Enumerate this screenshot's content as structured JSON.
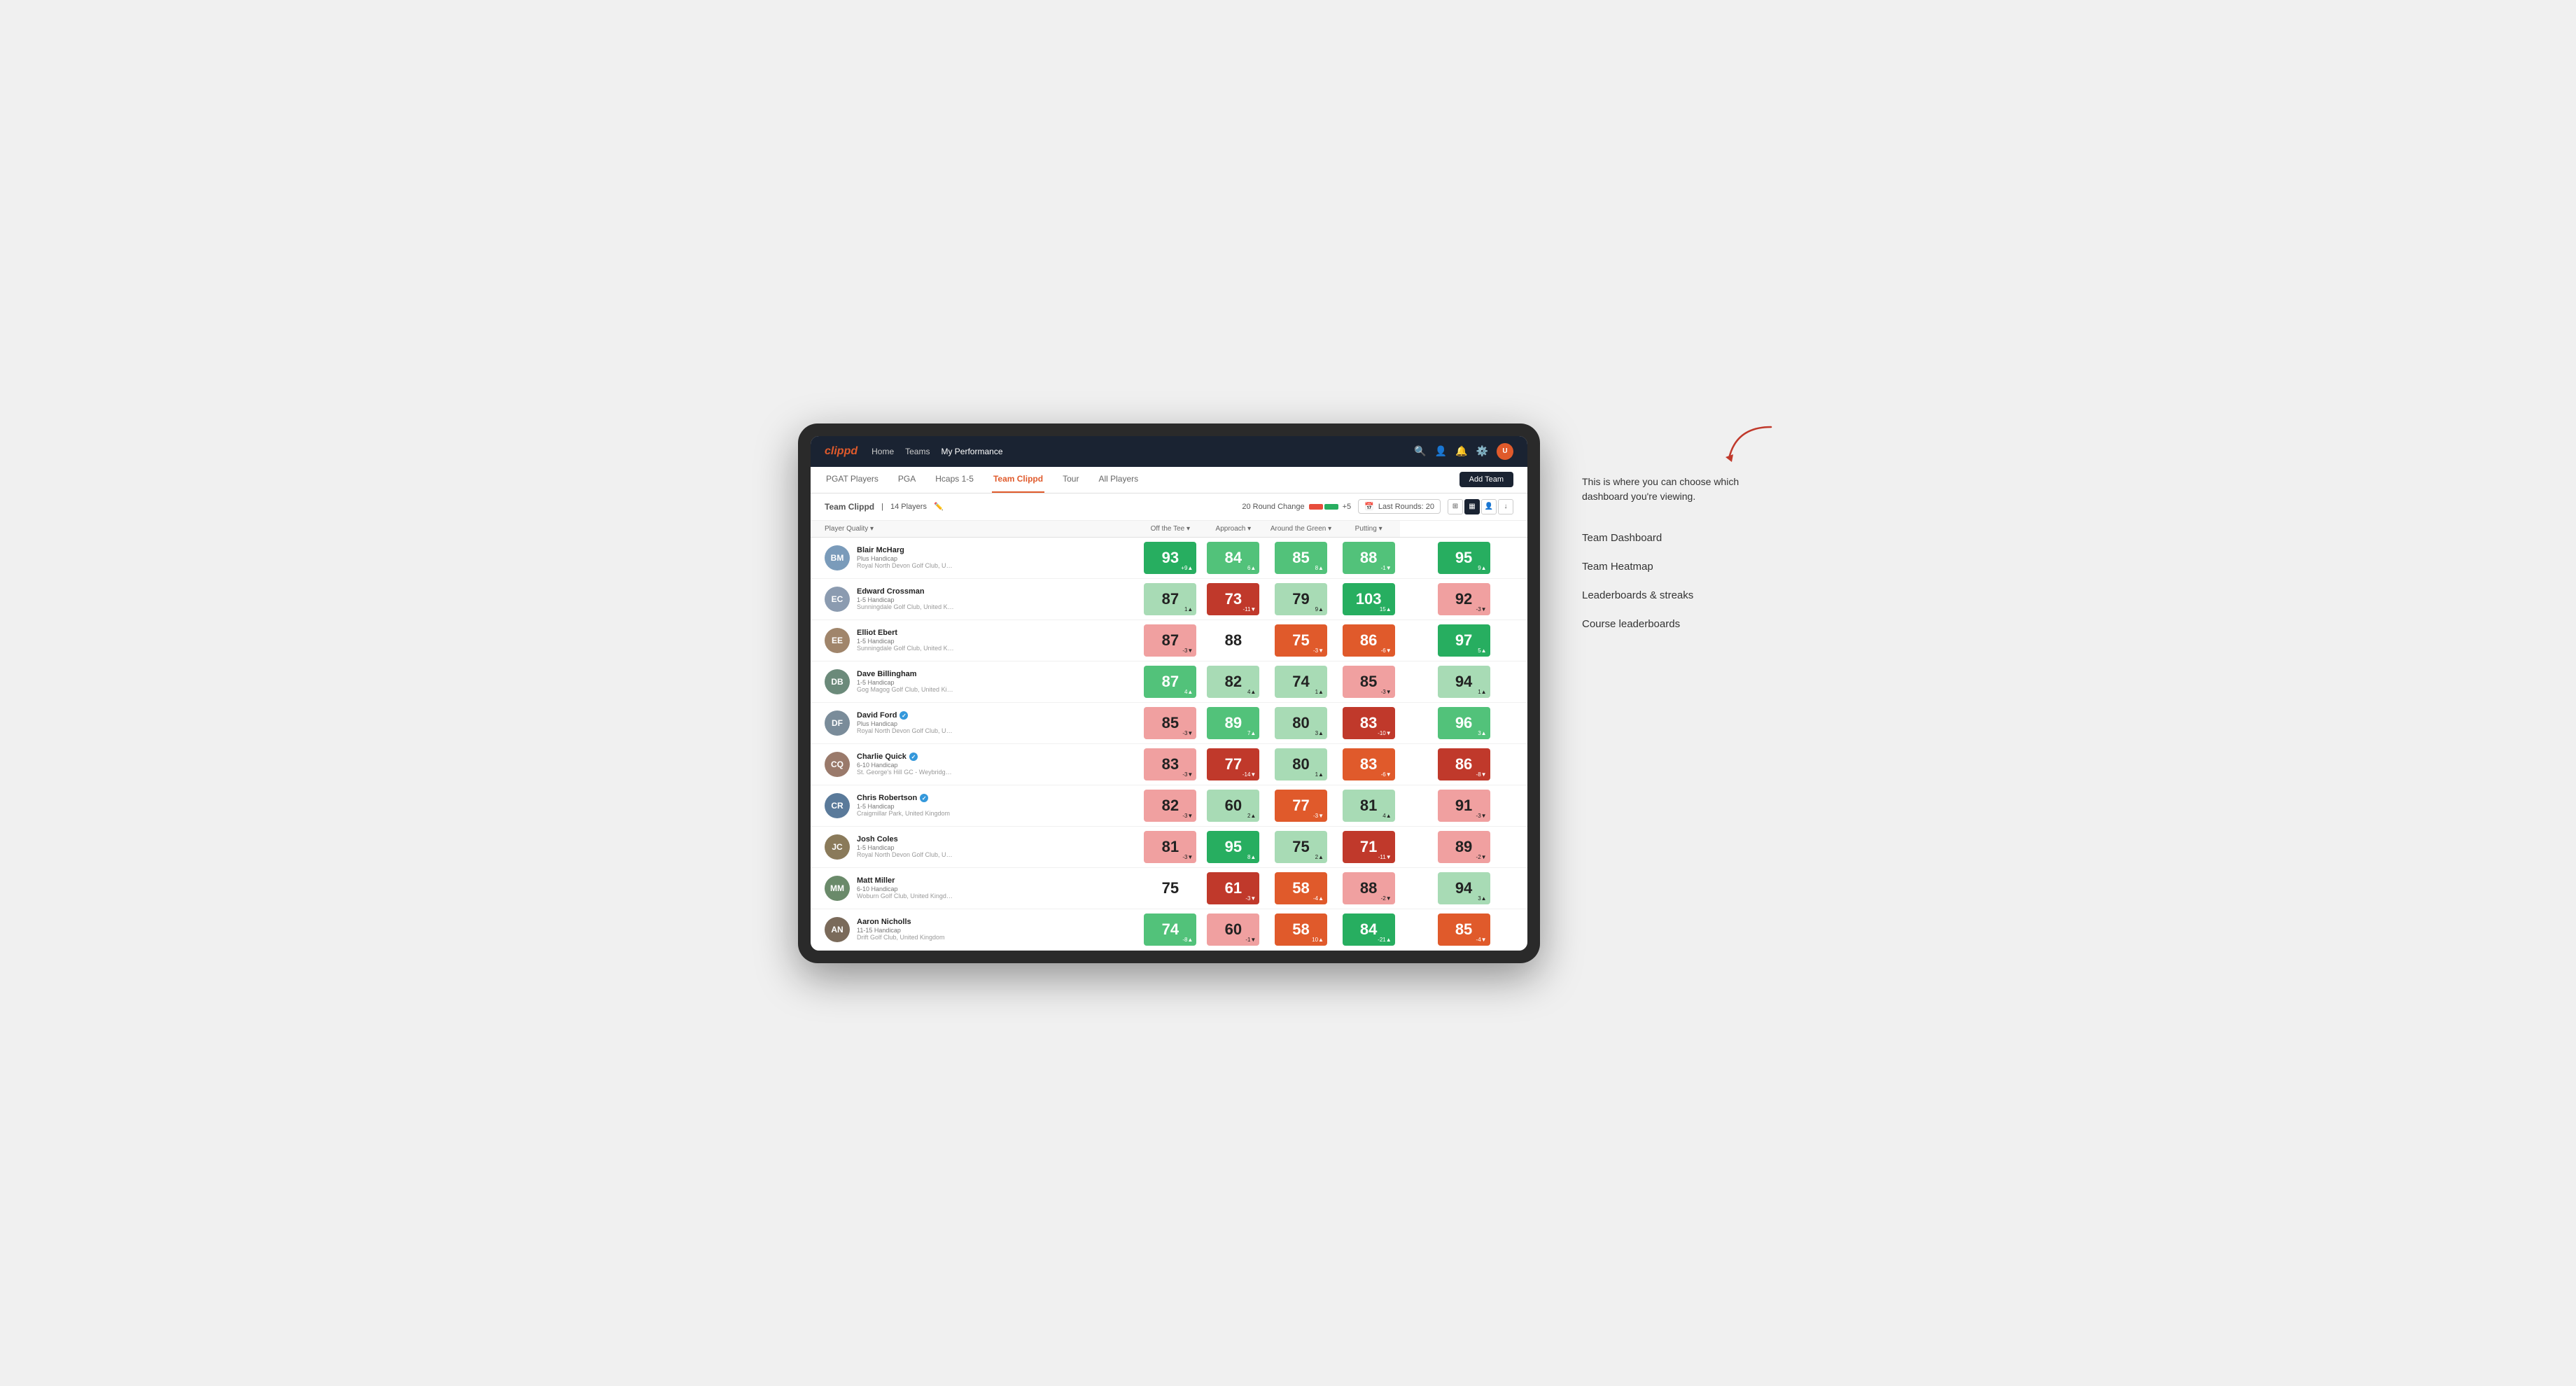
{
  "app": {
    "logo": "clippd",
    "nav": {
      "links": [
        {
          "label": "Home",
          "active": false
        },
        {
          "label": "Teams",
          "active": false
        },
        {
          "label": "My Performance",
          "active": true
        }
      ]
    },
    "sub_nav": {
      "links": [
        {
          "label": "PGAT Players",
          "active": false
        },
        {
          "label": "PGA",
          "active": false
        },
        {
          "label": "Hcaps 1-5",
          "active": false
        },
        {
          "label": "Team Clippd",
          "active": true
        },
        {
          "label": "Tour",
          "active": false
        },
        {
          "label": "All Players",
          "active": false
        }
      ],
      "add_team_label": "Add Team"
    }
  },
  "table_meta": {
    "team_name": "Team Clippd",
    "player_count": "14 Players",
    "round_change_label": "20 Round Change",
    "range_min": "-5",
    "range_max": "+5",
    "last_rounds_label": "Last Rounds:",
    "last_rounds_value": "20"
  },
  "table": {
    "columns": [
      {
        "label": "Player Quality",
        "has_arrow": true
      },
      {
        "label": "Off the Tee",
        "has_arrow": true
      },
      {
        "label": "Approach",
        "has_arrow": true
      },
      {
        "label": "Around the Green",
        "has_arrow": true
      },
      {
        "label": "Putting",
        "has_arrow": true
      }
    ],
    "rows": [
      {
        "name": "Blair McHarg",
        "handicap": "Plus Handicap",
        "club": "Royal North Devon Golf Club, United Kingdom",
        "avatar_color": "#7a9bba",
        "avatar_initials": "BM",
        "scores": [
          {
            "value": 93,
            "delta": "+9",
            "dir": "up",
            "color": "green-dark"
          },
          {
            "value": 84,
            "delta": "6",
            "dir": "up",
            "color": "green-mid"
          },
          {
            "value": 85,
            "delta": "8",
            "dir": "up",
            "color": "green-mid"
          },
          {
            "value": 88,
            "delta": "-1",
            "dir": "down",
            "color": "green-mid"
          },
          {
            "value": 95,
            "delta": "9",
            "dir": "up",
            "color": "green-dark"
          }
        ]
      },
      {
        "name": "Edward Crossman",
        "handicap": "1-5 Handicap",
        "club": "Sunningdale Golf Club, United Kingdom",
        "avatar_color": "#8b9bb0",
        "avatar_initials": "EC",
        "scores": [
          {
            "value": 87,
            "delta": "1",
            "dir": "up",
            "color": "green-light"
          },
          {
            "value": 73,
            "delta": "-11",
            "dir": "down",
            "color": "red-dark"
          },
          {
            "value": 79,
            "delta": "9",
            "dir": "up",
            "color": "green-light"
          },
          {
            "value": 103,
            "delta": "15",
            "dir": "up",
            "color": "green-dark"
          },
          {
            "value": 92,
            "delta": "-3",
            "dir": "down",
            "color": "red-light"
          }
        ]
      },
      {
        "name": "Elliot Ebert",
        "handicap": "1-5 Handicap",
        "club": "Sunningdale Golf Club, United Kingdom",
        "avatar_color": "#a0856b",
        "avatar_initials": "EE",
        "scores": [
          {
            "value": 87,
            "delta": "-3",
            "dir": "down",
            "color": "red-light"
          },
          {
            "value": 88,
            "delta": "",
            "dir": "",
            "color": "white-bg"
          },
          {
            "value": 75,
            "delta": "-3",
            "dir": "down",
            "color": "red-mid"
          },
          {
            "value": 86,
            "delta": "-6",
            "dir": "down",
            "color": "red-mid"
          },
          {
            "value": 97,
            "delta": "5",
            "dir": "up",
            "color": "green-dark"
          }
        ]
      },
      {
        "name": "Dave Billingham",
        "handicap": "1-5 Handicap",
        "club": "Gog Magog Golf Club, United Kingdom",
        "avatar_color": "#6b8a7a",
        "avatar_initials": "DB",
        "scores": [
          {
            "value": 87,
            "delta": "4",
            "dir": "up",
            "color": "green-mid"
          },
          {
            "value": 82,
            "delta": "4",
            "dir": "up",
            "color": "green-light"
          },
          {
            "value": 74,
            "delta": "1",
            "dir": "up",
            "color": "green-light"
          },
          {
            "value": 85,
            "delta": "-3",
            "dir": "down",
            "color": "red-light"
          },
          {
            "value": 94,
            "delta": "1",
            "dir": "up",
            "color": "green-light"
          }
        ]
      },
      {
        "name": "David Ford",
        "handicap": "Plus Handicap",
        "club": "Royal North Devon Golf Club, United Kingdom",
        "avatar_color": "#7a8c9a",
        "avatar_initials": "DF",
        "verified": true,
        "scores": [
          {
            "value": 85,
            "delta": "-3",
            "dir": "down",
            "color": "red-light"
          },
          {
            "value": 89,
            "delta": "7",
            "dir": "up",
            "color": "green-mid"
          },
          {
            "value": 80,
            "delta": "3",
            "dir": "up",
            "color": "green-light"
          },
          {
            "value": 83,
            "delta": "-10",
            "dir": "down",
            "color": "red-dark"
          },
          {
            "value": 96,
            "delta": "3",
            "dir": "up",
            "color": "green-mid"
          }
        ]
      },
      {
        "name": "Charlie Quick",
        "handicap": "6-10 Handicap",
        "club": "St. George's Hill GC - Weybridge - Surrey, Uni...",
        "avatar_color": "#9a7a6b",
        "avatar_initials": "CQ",
        "verified": true,
        "scores": [
          {
            "value": 83,
            "delta": "-3",
            "dir": "down",
            "color": "red-light"
          },
          {
            "value": 77,
            "delta": "-14",
            "dir": "down",
            "color": "red-dark"
          },
          {
            "value": 80,
            "delta": "1",
            "dir": "up",
            "color": "green-light"
          },
          {
            "value": 83,
            "delta": "-6",
            "dir": "down",
            "color": "red-mid"
          },
          {
            "value": 86,
            "delta": "-8",
            "dir": "down",
            "color": "red-dark"
          }
        ]
      },
      {
        "name": "Chris Robertson",
        "handicap": "1-5 Handicap",
        "club": "Craigmillar Park, United Kingdom",
        "avatar_color": "#5a7a9a",
        "avatar_initials": "CR",
        "verified": true,
        "scores": [
          {
            "value": 82,
            "delta": "-3",
            "dir": "down",
            "color": "red-light"
          },
          {
            "value": 60,
            "delta": "2",
            "dir": "up",
            "color": "green-light"
          },
          {
            "value": 77,
            "delta": "-3",
            "dir": "down",
            "color": "red-mid"
          },
          {
            "value": 81,
            "delta": "4",
            "dir": "up",
            "color": "green-light"
          },
          {
            "value": 91,
            "delta": "-3",
            "dir": "down",
            "color": "red-light"
          }
        ]
      },
      {
        "name": "Josh Coles",
        "handicap": "1-5 Handicap",
        "club": "Royal North Devon Golf Club, United Kingdom",
        "avatar_color": "#8a7a5a",
        "avatar_initials": "JC",
        "scores": [
          {
            "value": 81,
            "delta": "-3",
            "dir": "down",
            "color": "red-light"
          },
          {
            "value": 95,
            "delta": "8",
            "dir": "up",
            "color": "green-dark"
          },
          {
            "value": 75,
            "delta": "2",
            "dir": "up",
            "color": "green-light"
          },
          {
            "value": 71,
            "delta": "-11",
            "dir": "down",
            "color": "red-dark"
          },
          {
            "value": 89,
            "delta": "-2",
            "dir": "down",
            "color": "red-light"
          }
        ]
      },
      {
        "name": "Matt Miller",
        "handicap": "6-10 Handicap",
        "club": "Woburn Golf Club, United Kingdom",
        "avatar_color": "#6a8a6a",
        "avatar_initials": "MM",
        "scores": [
          {
            "value": 75,
            "delta": "",
            "dir": "",
            "color": "white-bg"
          },
          {
            "value": 61,
            "delta": "-3",
            "dir": "down",
            "color": "red-dark"
          },
          {
            "value": 58,
            "delta": "-4",
            "dir": "up",
            "color": "red-mid"
          },
          {
            "value": 88,
            "delta": "-2",
            "dir": "down",
            "color": "red-light"
          },
          {
            "value": 94,
            "delta": "3",
            "dir": "up",
            "color": "green-light"
          }
        ]
      },
      {
        "name": "Aaron Nicholls",
        "handicap": "11-15 Handicap",
        "club": "Drift Golf Club, United Kingdom",
        "avatar_color": "#7a6a5a",
        "avatar_initials": "AN",
        "scores": [
          {
            "value": 74,
            "delta": "-8",
            "dir": "up",
            "color": "green-mid"
          },
          {
            "value": 60,
            "delta": "-1",
            "dir": "down",
            "color": "red-light"
          },
          {
            "value": 58,
            "delta": "10",
            "dir": "up",
            "color": "red-mid"
          },
          {
            "value": 84,
            "delta": "-21",
            "dir": "up",
            "color": "green-dark"
          },
          {
            "value": 85,
            "delta": "-4",
            "dir": "down",
            "color": "red-mid"
          }
        ]
      }
    ]
  },
  "annotation": {
    "intro": "This is where you can choose which dashboard you're viewing.",
    "items": [
      "Team Dashboard",
      "Team Heatmap",
      "Leaderboards & streaks",
      "Course leaderboards"
    ]
  }
}
